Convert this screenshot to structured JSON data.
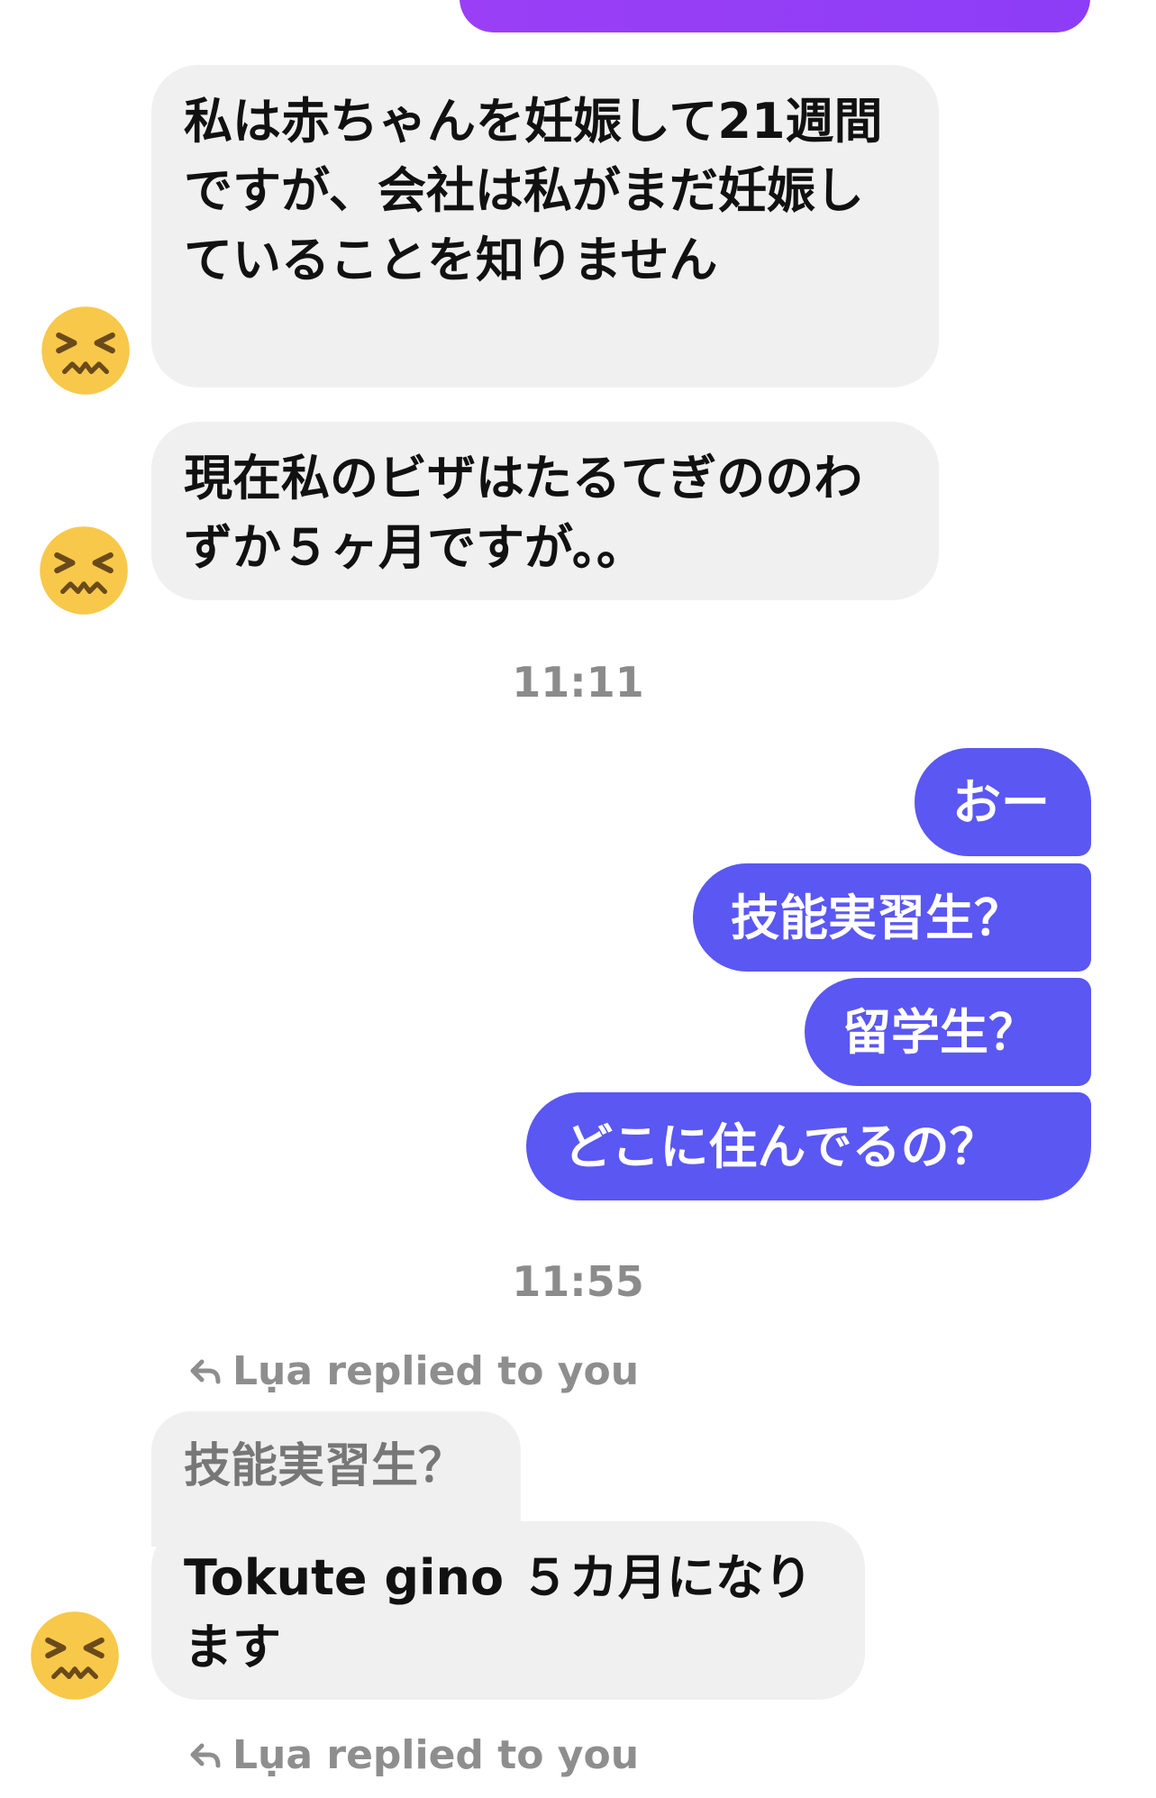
{
  "messages": {
    "incoming_1": "私は赤ちゃんを妊娠して21週間ですが、会社は私がまだ妊娠していることを知りません",
    "incoming_2": "現在私のビザはたるてぎののわずか５ヶ月ですが。。",
    "time_1": "11:11",
    "outgoing_1": "おー",
    "outgoing_2": "技能実習生？",
    "outgoing_3": "留学生？",
    "outgoing_4": "どこに住んでるの？",
    "time_2": "11:55",
    "reply_label_1": "Lụa replied to you",
    "quoted_text": "技能実習生？",
    "incoming_3": "Tokute gino ５カ月になります",
    "reply_label_2": "Lụa replied to you"
  },
  "colors": {
    "incoming_bg": "#f0f0f0",
    "outgoing_bg": "#5a57f3",
    "top_bubble": "#9a3ff6",
    "timestamp": "#8b8b8b",
    "emoji_yellow": "#f8c84a"
  },
  "icons": {
    "avatar": "confounded-face-emoji",
    "reply": "reply-arrow-icon"
  }
}
